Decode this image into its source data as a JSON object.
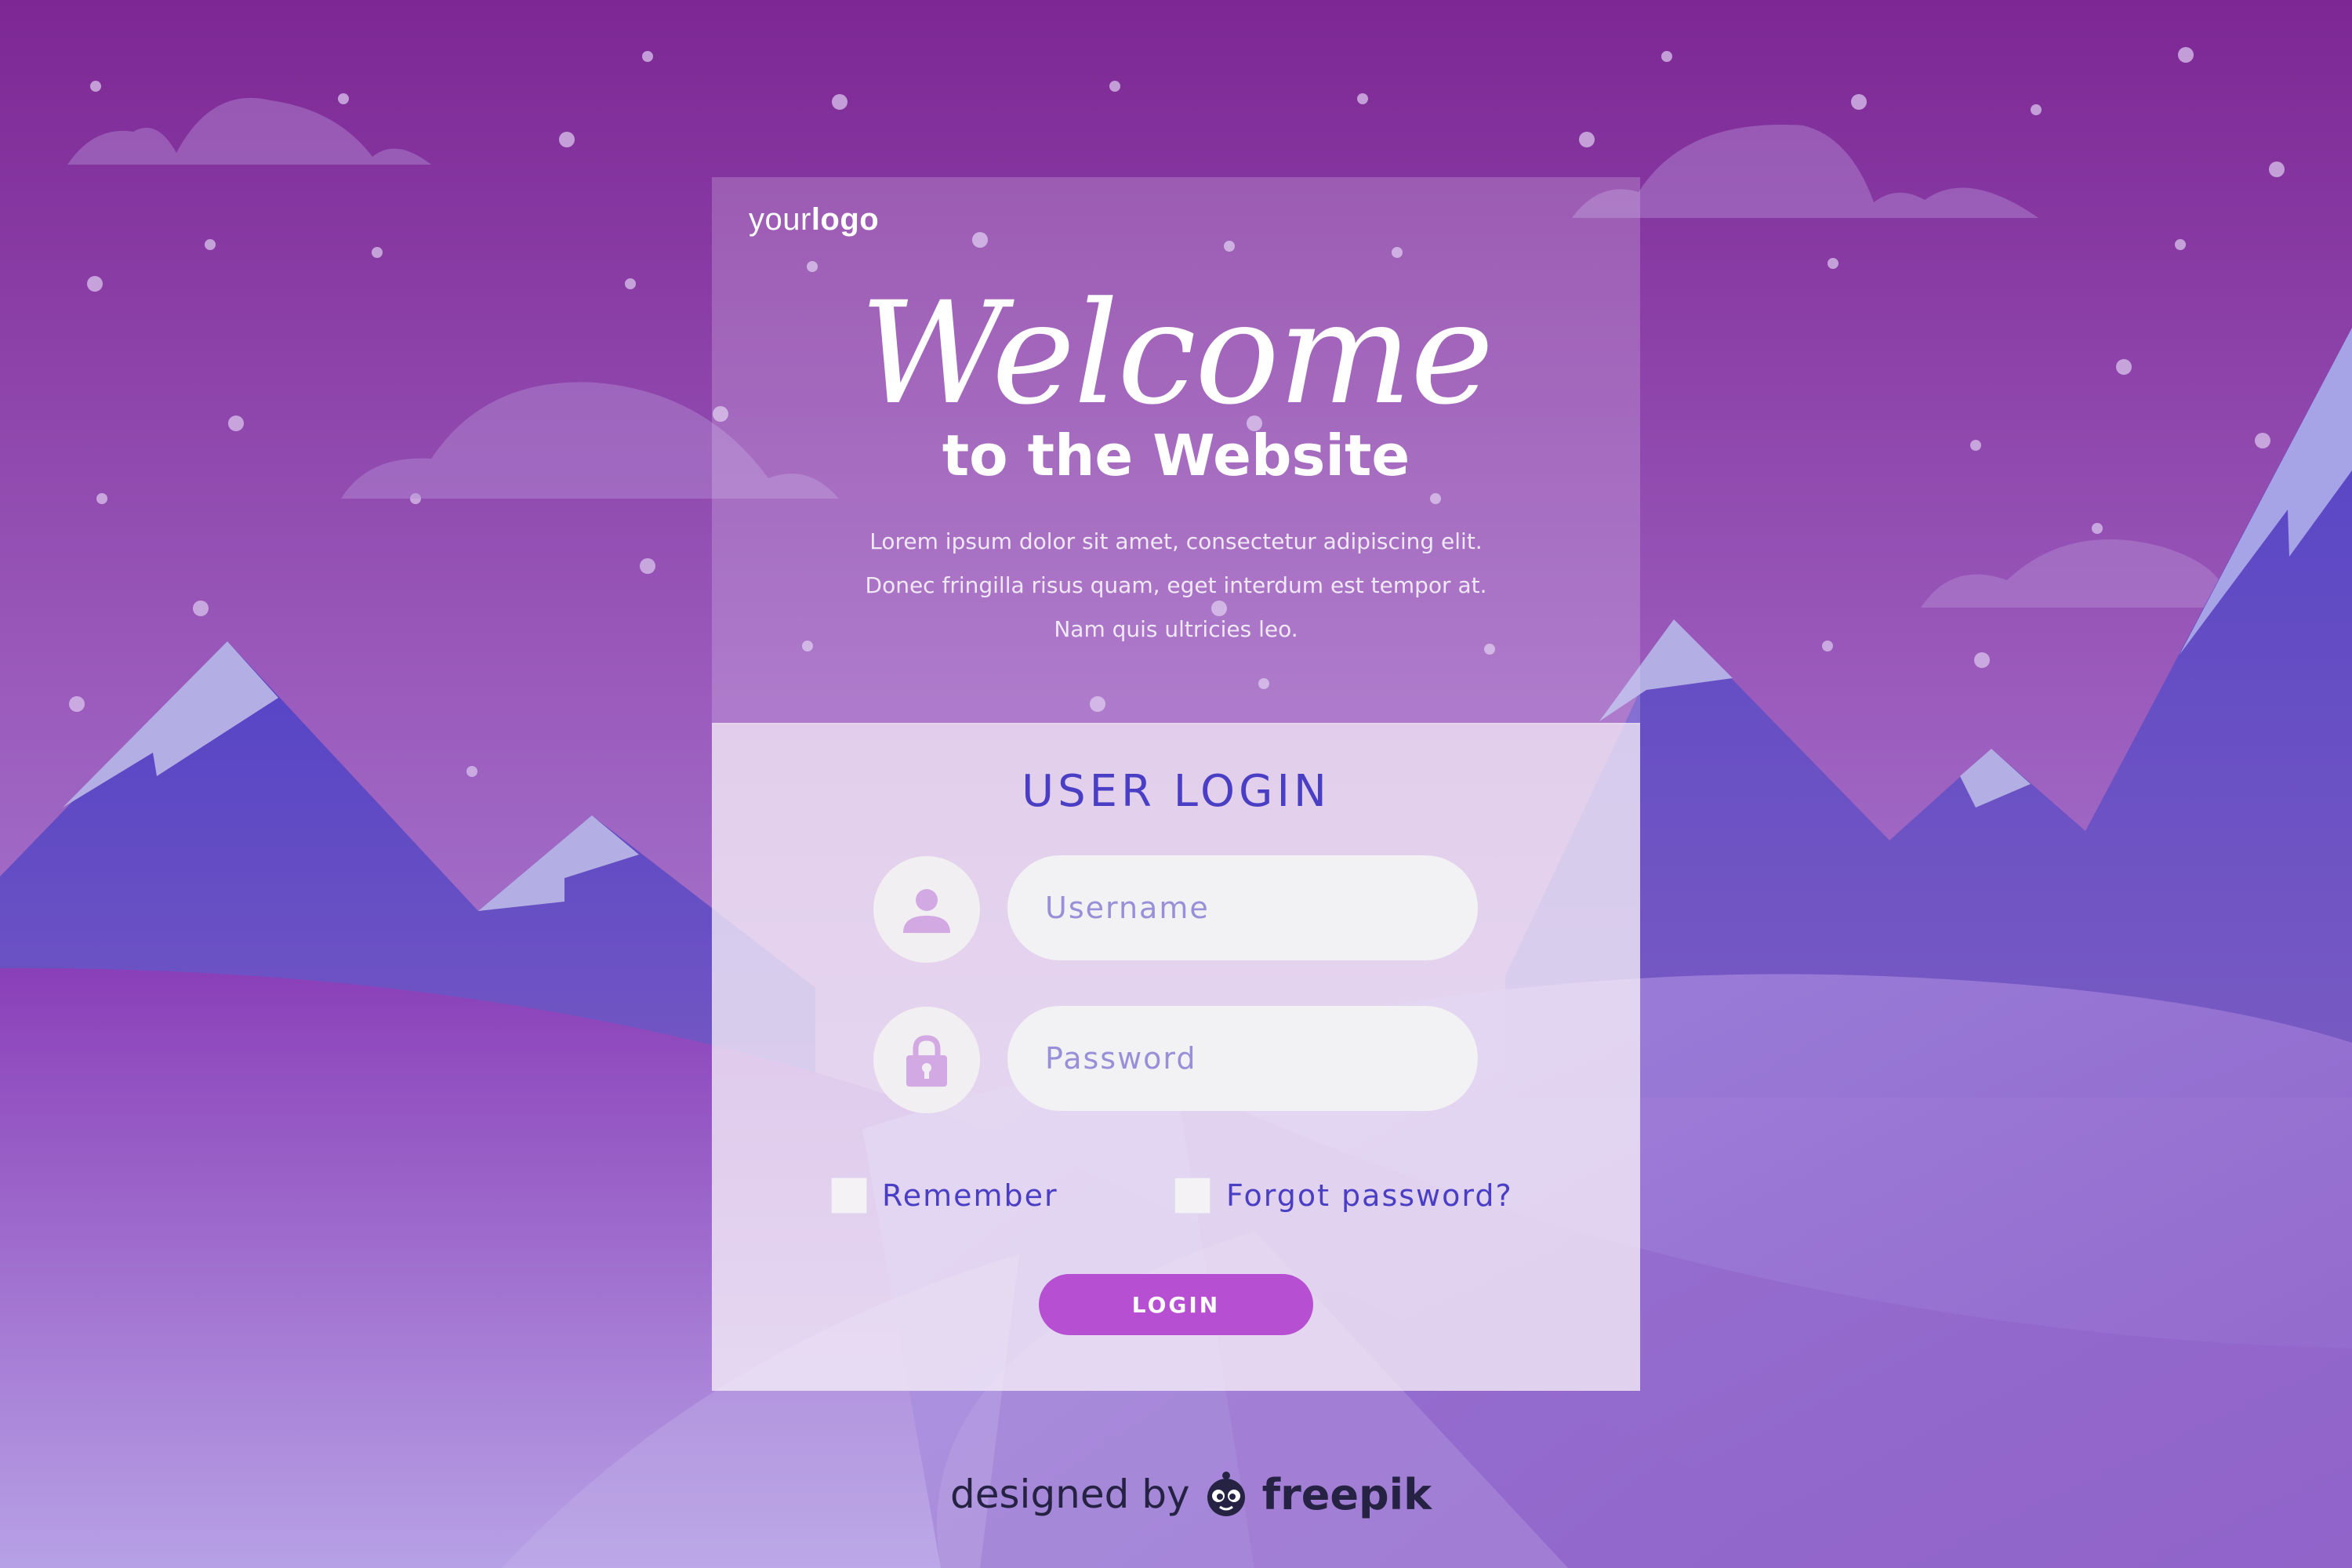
{
  "brand": {
    "your": "your",
    "logo": "logo"
  },
  "hero": {
    "title": "Welcome",
    "subtitle": "to the Website",
    "description": [
      "Lorem ipsum dolor sit amet, consectetur adipiscing elit.",
      "Donec fringilla risus quam, eget interdum est tempor at.",
      "Nam quis ultricies leo."
    ]
  },
  "login": {
    "heading": "USER LOGIN",
    "username": {
      "placeholder": "Username",
      "value": "",
      "icon": "user-icon"
    },
    "password": {
      "placeholder": "Password",
      "value": "",
      "icon": "lock-icon"
    },
    "remember_label": "Remember",
    "forgot_label": "Forgot password?",
    "button_label": "LOGIN"
  },
  "credit": {
    "designed_by": "designed by",
    "brand": "freepik",
    "icon": "freepik-mascot-icon"
  },
  "colors": {
    "sky_top": "#7d2794",
    "sky_bottom": "#b49ee3",
    "mountain": "#5b4cc4",
    "accent": "#4a3fc4",
    "button": "#b64fd1"
  }
}
